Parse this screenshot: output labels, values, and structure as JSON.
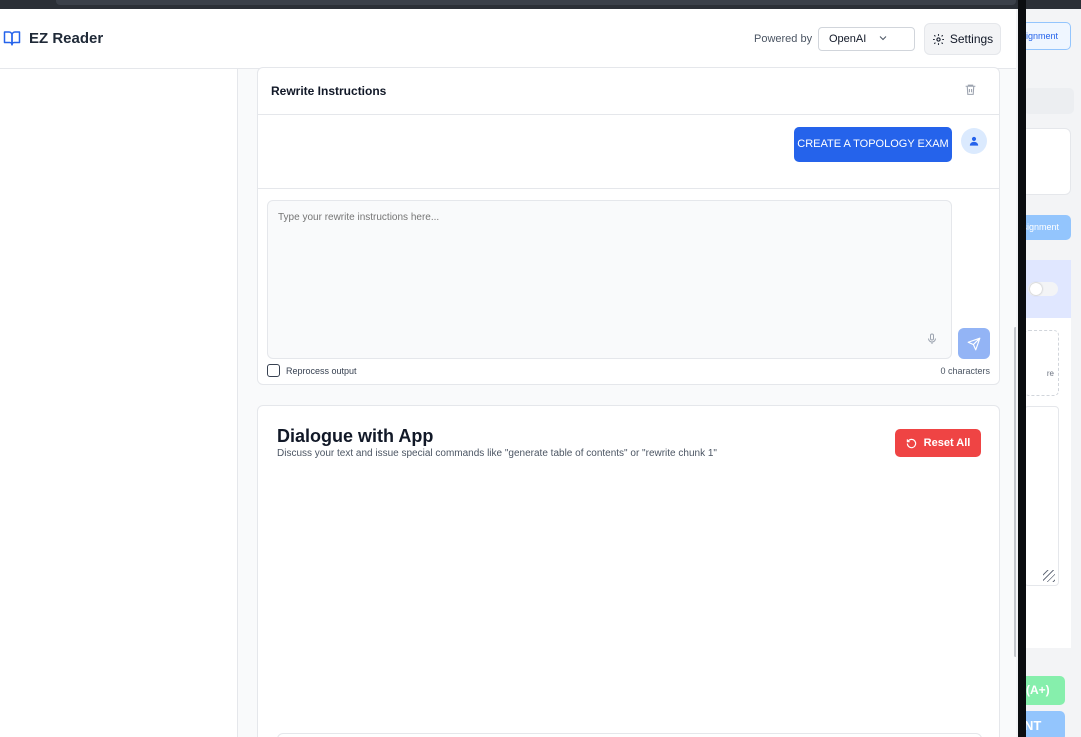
{
  "app": {
    "title": "EZ Reader",
    "book_icon": "book-open-icon"
  },
  "header": {
    "powered_by_label": "Powered by",
    "provider_selected": "OpenAI",
    "settings_label": "Settings",
    "settings_icon": "gear-icon"
  },
  "rewrite": {
    "title": "Rewrite Instructions",
    "user_message": "CREATE A TOPOLOGY EXAM",
    "input_placeholder": "Type your rewrite instructions here...",
    "input_value": "",
    "reprocess_label": "Reprocess output",
    "reprocess_checked": false,
    "char_count": "0 characters"
  },
  "dialogue": {
    "title": "Dialogue with App",
    "subtitle": "Discuss your text and issue special commands like \"generate table of contents\" or \"rewrite chunk 1\"",
    "reset_label": "Reset All"
  },
  "background_app": {
    "outline_button_text": "Assignment",
    "light_button_text": "Assignment",
    "dashed_text": "re",
    "green_button_text": "(A+)",
    "blue_button_text": "NT"
  },
  "colors": {
    "primary": "#2563eb",
    "danger": "#ef4444",
    "send_disabled": "#93b4f5",
    "avatar_bg": "#dbeafe"
  }
}
